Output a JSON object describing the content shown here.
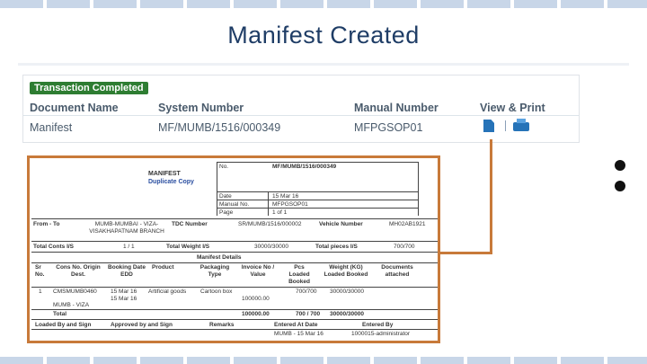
{
  "slide": {
    "title": "Manifest Created"
  },
  "transaction": {
    "badge": "Transaction Completed",
    "headers": {
      "document_name": "Document Name",
      "system_number": "System Number",
      "manual_number": "Manual Number",
      "view_print": "View & Print"
    },
    "row": {
      "document_name": "Manifest",
      "system_number": "MF/MUMB/1516/000349",
      "manual_number": "MFPGSOP01",
      "separator": "|"
    },
    "icons": [
      "document-icon",
      "printer-icon"
    ]
  },
  "manifest_doc": {
    "title": "MANIFEST",
    "subtitle": "Duplicate Copy",
    "info": [
      {
        "label": "No.",
        "value": "MF/MUMB/1516/000349"
      },
      {
        "label": "Date",
        "value": "15 Mar 16"
      },
      {
        "label": "Manual No.",
        "value": "MFPGSOP01"
      },
      {
        "label": "Page",
        "value": "1 of 1"
      }
    ],
    "row1": {
      "from_to_label": "From - To",
      "from_to_value": "MUMB-MUMBAI - VIZA-VISAKHAPATNAM BRANCH",
      "tdc_label": "TDC Number",
      "tdc_value": "SR/MUMB/1516/000002",
      "vehicle_label": "Vehicle Number",
      "vehicle_value": "MH02AB1921"
    },
    "row2": {
      "total_conts_label": "Total Conts I/S",
      "total_conts_value": "1 / 1",
      "total_weight_label": "Total Weight I/S",
      "total_weight_value": "30000/30000",
      "total_pieces_label": "Total pieces I/S",
      "total_pieces_value": "700/700"
    },
    "details_title": "Manifest Details",
    "columns": [
      "Sr No.",
      "Cons No. Origin Dest.",
      "Booking Date EDD",
      "Product",
      "Packaging Type",
      "Invoice No / Value",
      "Pcs Loaded Booked",
      "Weight (KG) Loaded Booked",
      "Documents attached"
    ],
    "row": {
      "sr": "1",
      "cons_no": "CMSMUMB0460",
      "booking_date": "15 Mar 16",
      "product": "Artificial goods",
      "packaging": "Cartoon box",
      "invoice": "100000.00",
      "pcs": "700/700",
      "weight": "30000/30000",
      "route": "MUMB - VIZA",
      "edd": "15 Mar 16"
    },
    "total": {
      "label": "Total",
      "invoice": "100000.00",
      "pcs": "700 / 700",
      "weight": "30000/30000"
    },
    "footer_headers": [
      "Loaded By and Sign",
      "Approved by and Sign",
      "Remarks",
      "Entered At Date",
      "Entered By"
    ],
    "footer_values": {
      "entered_at": "MUMB - 15 Mar 16",
      "entered_by": "1000015-administrator"
    }
  },
  "colors": {
    "title": "#1f3d66",
    "badge": "#2e7d32",
    "connector": "#c87a3a",
    "link_blue": "#2a4ea0"
  }
}
